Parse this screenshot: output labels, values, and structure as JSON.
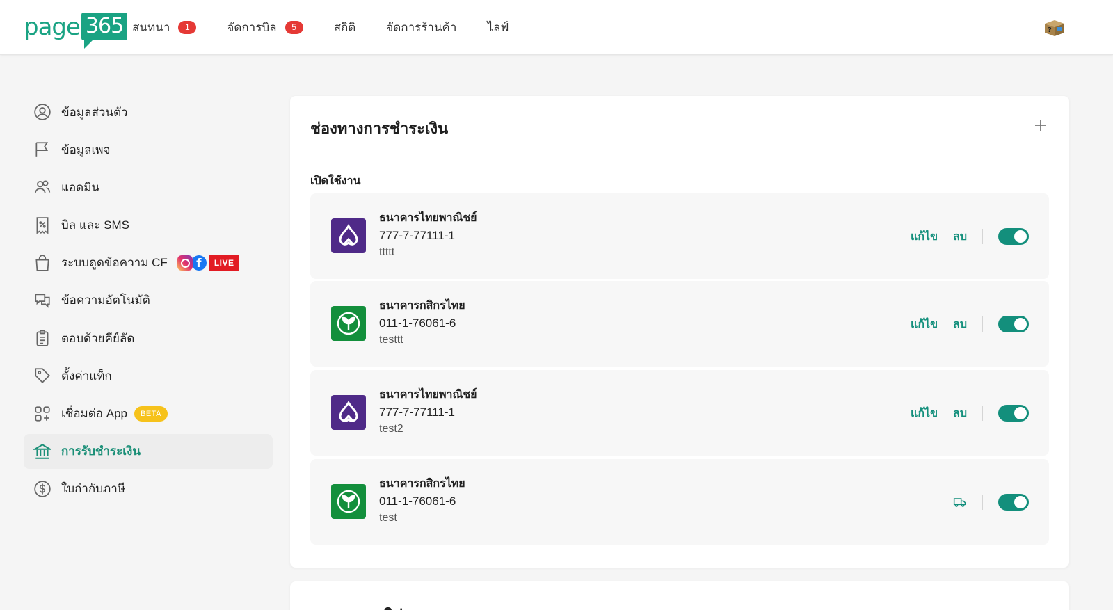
{
  "app": {
    "logo_text": "page",
    "logo_number": "365"
  },
  "nav": {
    "items": [
      {
        "label": "สนทนา",
        "badge": "1"
      },
      {
        "label": "จัดการบิล",
        "badge": "5"
      },
      {
        "label": "สถิติ",
        "badge": null
      },
      {
        "label": "จัดการร้านค้า",
        "badge": null
      },
      {
        "label": "ไลฟ์",
        "badge": null
      }
    ]
  },
  "sidebar": {
    "items": [
      {
        "label": "ข้อมูลส่วนตัว",
        "icon": "user-circle-icon"
      },
      {
        "label": "ข้อมูลเพจ",
        "icon": "flag-icon"
      },
      {
        "label": "แอดมิน",
        "icon": "users-icon"
      },
      {
        "label": "บิล และ SMS",
        "icon": "receipt-icon"
      },
      {
        "label": "ระบบดูดข้อความ CF",
        "icon": "shopping-bag-icon",
        "live_label": "LIVE",
        "facebook_glyph": "f"
      },
      {
        "label": "ข้อความอัตโนมัติ",
        "icon": "chat-bubbles-icon"
      },
      {
        "label": "ตอบด้วยคีย์ลัด",
        "icon": "clipboard-list-icon"
      },
      {
        "label": "ตั้งค่าแท็ก",
        "icon": "tag-icon"
      },
      {
        "label": "เชื่อมต่อ App",
        "icon": "apps-grid-icon",
        "beta_label": "BETA"
      },
      {
        "label": "การรับชำระเงิน",
        "icon": "bank-icon",
        "active": true
      },
      {
        "label": "ใบกำกับภาษี",
        "icon": "dollar-circle-icon"
      }
    ]
  },
  "payment_card": {
    "title": "ช่องทางการชำระเงิน",
    "section_label": "เปิดใช้งาน",
    "edit_label": "แก้ไข",
    "delete_label": "ลบ",
    "accounts": [
      {
        "bank": "ธนาคารไทยพาณิชย์",
        "account": "777-7-77111-1",
        "note": "ttttt",
        "logo": "scb",
        "enabled": true,
        "actions": "edit-delete"
      },
      {
        "bank": "ธนาคารกสิกรไทย",
        "account": "011-1-76061-6",
        "note": "testtt",
        "logo": "kbank",
        "enabled": true,
        "actions": "edit-delete"
      },
      {
        "bank": "ธนาคารไทยพาณิชย์",
        "account": "777-7-77111-1",
        "note": "test2",
        "logo": "scb",
        "enabled": true,
        "actions": "edit-delete"
      },
      {
        "bank": "ธนาคารกสิกรไทย",
        "account": "011-1-76061-6",
        "note": "test",
        "logo": "kbank",
        "enabled": true,
        "actions": "truck"
      }
    ]
  },
  "second_card": {
    "title": "ตรวจสอบสลิป"
  },
  "colors": {
    "brand": "#1aa383",
    "accent": "#138f7c",
    "badge": "#e53935",
    "scb": "#4f2a88",
    "kbank": "#138f3c",
    "beta": "#f6c21b",
    "live": "#e21b23"
  }
}
